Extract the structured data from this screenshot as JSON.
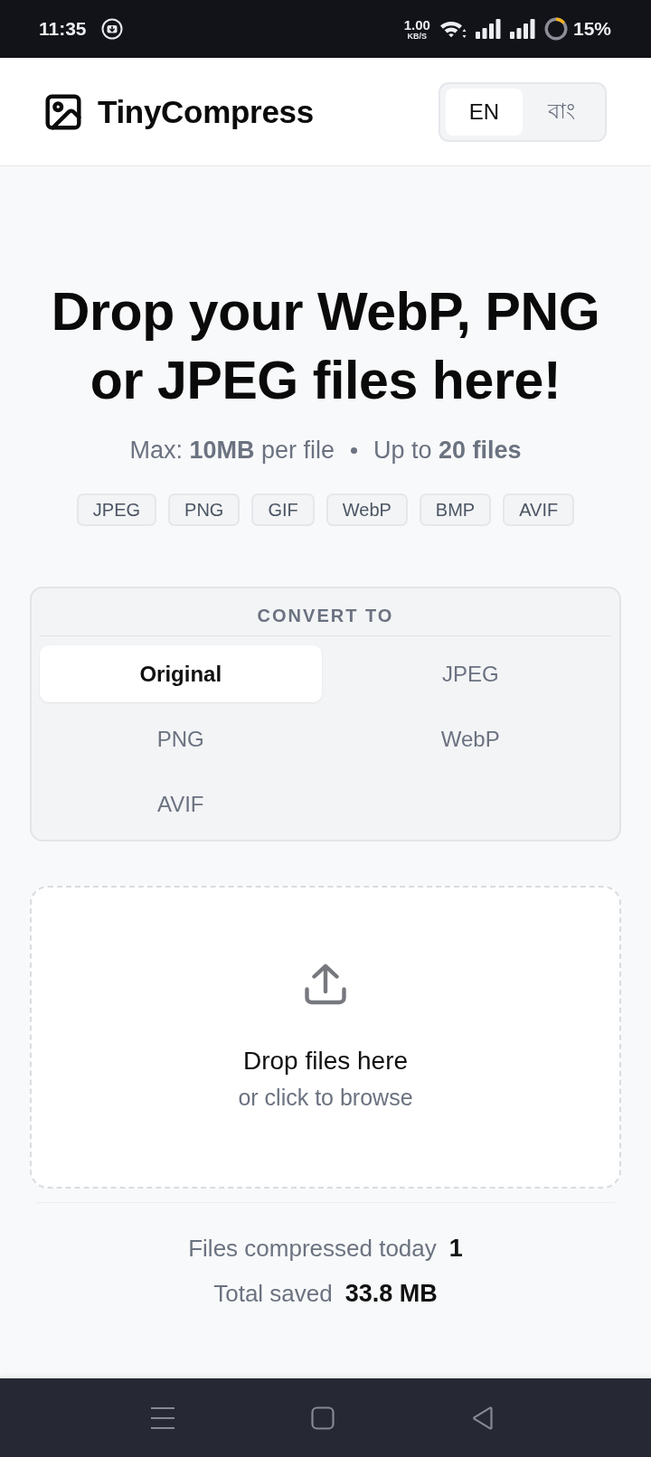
{
  "status_bar": {
    "time": "11:35",
    "net_speed": "1.00",
    "net_unit": "KB/S",
    "battery": "15%"
  },
  "header": {
    "app_name": "TinyCompress",
    "languages": [
      {
        "label": "EN",
        "selected": true
      },
      {
        "label": "বাং",
        "selected": false
      }
    ]
  },
  "hero": {
    "title": "Drop your WebP, PNG or JPEG files here!",
    "limits": [
      "Max: **10MB** per file",
      "Up to **20 files**"
    ],
    "formats": [
      "JPEG",
      "PNG",
      "GIF",
      "WebP",
      "BMP",
      "AVIF"
    ]
  },
  "convert": {
    "heading": "CONVERT TO",
    "options": [
      {
        "label": "Original",
        "selected": true
      },
      {
        "label": "JPEG",
        "selected": false
      },
      {
        "label": "PNG",
        "selected": false
      },
      {
        "label": "WebP",
        "selected": false
      },
      {
        "label": "AVIF",
        "selected": false
      }
    ]
  },
  "dropzone": {
    "title": "Drop files here",
    "hint": "or click to browse"
  },
  "stats": [
    {
      "label": "Files compressed today",
      "value": "1"
    },
    {
      "label": "Total saved",
      "value": "33.8 MB"
    }
  ]
}
